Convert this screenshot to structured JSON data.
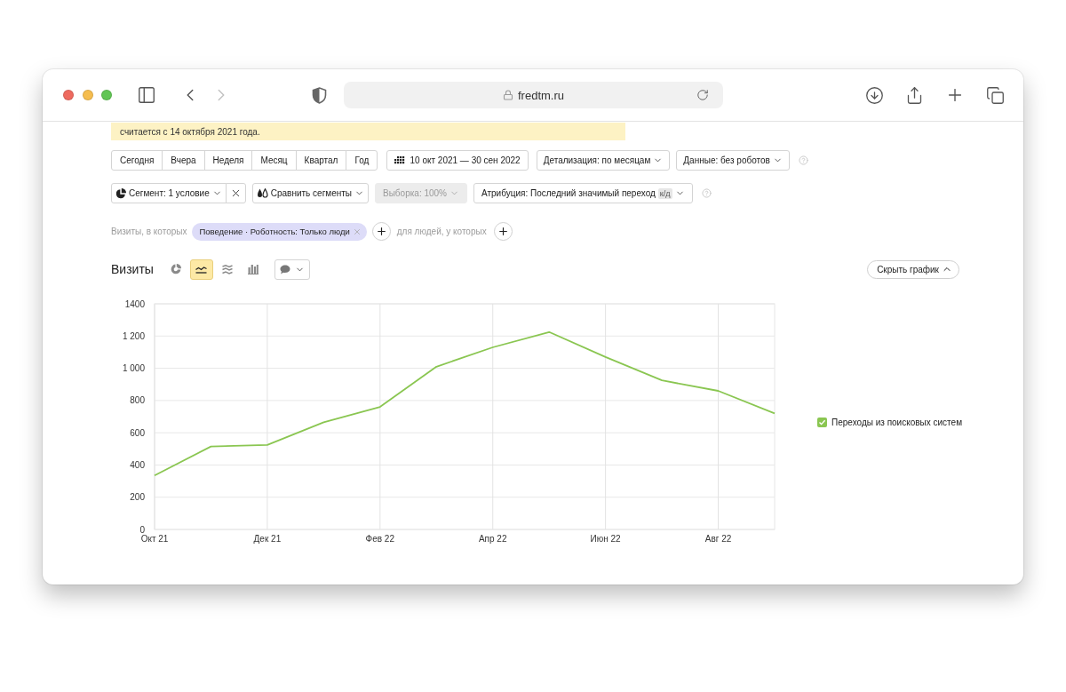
{
  "browser": {
    "url": "fredtm.ru",
    "nav": [
      {
        "kind": "back",
        "disabled": false
      },
      {
        "kind": "forward",
        "disabled": true
      }
    ]
  },
  "notice": {
    "text": "считается с 14 октября 2021 года."
  },
  "period_row": {
    "periods": [
      "Сегодня",
      "Вчера",
      "Неделя",
      "Месяц",
      "Квартал",
      "Год"
    ],
    "date_range": "10 окт 2021 — 30 сен 2022",
    "dropdowns": [
      "Детализация: по месяцам",
      "Данные: без роботов"
    ]
  },
  "segment_row": {
    "segment": "Сегмент: 1 условие",
    "compare": "Сравнить сегменты",
    "sample": {
      "label": "Выборка: 100%",
      "disabled": true
    },
    "attribution": {
      "label": "Атрибуция: Последний значимый переход",
      "badge": "к/д"
    }
  },
  "filter_row": {
    "visits_label": "Визиты, в которых",
    "chips": [
      "Поведение · Роботность: Только люди"
    ],
    "people_label": "для людей, у которых"
  },
  "chart_panel": {
    "title": "Визиты",
    "view_buttons": [
      {
        "kind": "pie",
        "selected": false
      },
      {
        "kind": "line",
        "selected": true
      },
      {
        "kind": "area",
        "selected": false
      },
      {
        "kind": "bar",
        "selected": false
      }
    ],
    "hide_button": "Скрыть график",
    "legend": [
      {
        "checked": true
      }
    ],
    "chart_data": {
      "type": "line",
      "categories": [
        "Окт 21",
        null,
        "Дек 21",
        null,
        "Фев 22",
        null,
        "Апр 22",
        null,
        "Июн 22",
        null,
        "Авг 22",
        null
      ],
      "series": [
        {
          "name": "Переходы из поисковых систем",
          "color": "#8ac651",
          "values": [
            335,
            515,
            525,
            665,
            760,
            1010,
            1130,
            1225,
            1070,
            925,
            860,
            720
          ]
        }
      ],
      "ylim": [
        0,
        1400
      ],
      "yticks": [
        0,
        200,
        400,
        600,
        800,
        {
          "value": 1000,
          "label": "1 000"
        },
        {
          "value": 1200,
          "label": "1 200"
        },
        1400
      ],
      "grid": true
    }
  }
}
